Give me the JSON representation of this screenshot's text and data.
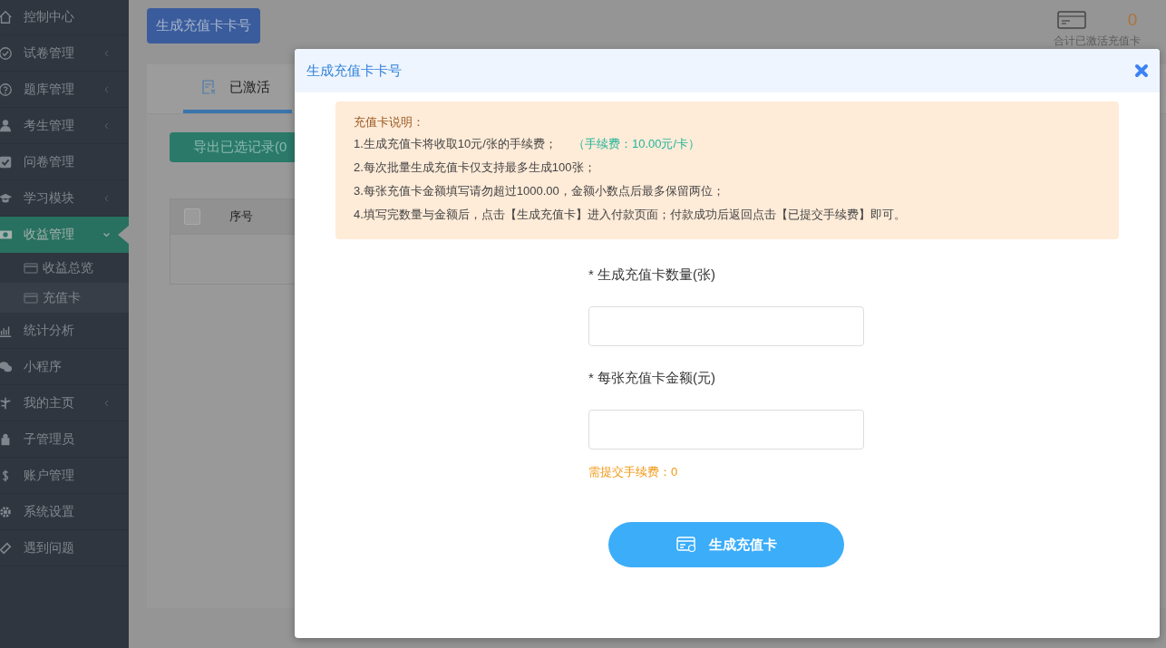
{
  "sidebar": {
    "items": [
      {
        "label": "控制中心",
        "selected": false
      },
      {
        "label": "试卷管理",
        "expanded": false,
        "selected": false
      },
      {
        "label": "题库管理",
        "expanded": false,
        "selected": false
      },
      {
        "label": "考生管理",
        "expanded": false,
        "selected": false
      },
      {
        "label": "问卷管理",
        "selected": false
      },
      {
        "label": "学习模块",
        "expanded": false,
        "selected": false
      },
      {
        "label": "收益管理",
        "expanded": true,
        "selected": true,
        "children": [
          {
            "label": "收益总览",
            "selected": false
          },
          {
            "label": "充值卡",
            "selected": true
          }
        ]
      },
      {
        "label": "统计分析",
        "selected": false
      },
      {
        "label": "小程序",
        "selected": false
      },
      {
        "label": "我的主页",
        "expanded": false,
        "selected": false
      },
      {
        "label": "子管理员",
        "selected": false
      },
      {
        "label": "账户管理",
        "selected": false
      },
      {
        "label": "系统设置",
        "selected": false
      },
      {
        "label": "遇到问题",
        "selected": false
      }
    ]
  },
  "page": {
    "generate_button": "生成充值卡卡号",
    "stat": {
      "value": "0",
      "label": "合计已激活充值卡"
    },
    "tabs": [
      {
        "label": "已激活",
        "selected": true
      }
    ],
    "export_button": "导出已选记录(0",
    "table": {
      "select_all": {
        "checked": false
      },
      "columns": [
        "序号"
      ]
    }
  },
  "modal": {
    "title": "生成充值卡卡号",
    "notice": {
      "title": "充值卡说明：",
      "lines": [
        {
          "text": "1.生成充值卡将收取10元/张的手续费；",
          "highlight": "（手续费：10.00元/卡）"
        },
        {
          "text": "2.每次批量生成充值卡仅支持最多生成100张；"
        },
        {
          "text": "3.每张充值卡金额填写请勿超过1000.00，金额小数点后最多保留两位；"
        },
        {
          "text": "4.填写完数量与金额后，点击【生成充值卡】进入付款页面；付款成功后返回点击【已提交手续费】即可。"
        }
      ]
    },
    "fields": [
      {
        "label": "* 生成充值卡数量(张)"
      },
      {
        "label": "* 每张充值卡金额(元)"
      }
    ],
    "fee_note": "需提交手续费：0",
    "submit_button": "生成充值卡"
  }
}
